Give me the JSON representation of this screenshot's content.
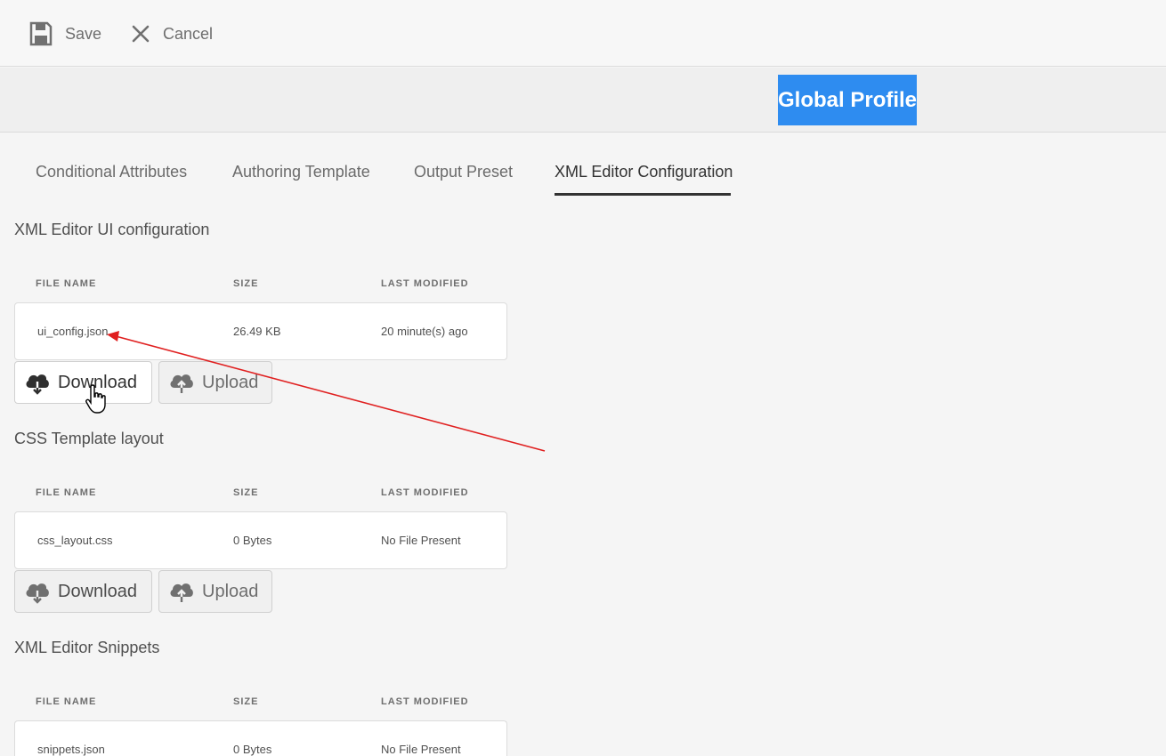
{
  "toolbar": {
    "save_label": "Save",
    "cancel_label": "Cancel"
  },
  "profile": {
    "title": "Global Profile"
  },
  "tabs": [
    {
      "label": "Conditional Attributes",
      "active": false
    },
    {
      "label": "Authoring Template",
      "active": false
    },
    {
      "label": "Output Preset",
      "active": false
    },
    {
      "label": "XML Editor Configuration",
      "active": true
    }
  ],
  "columns": {
    "file_name": "FILE NAME",
    "size": "SIZE",
    "last_modified": "LAST MODIFIED"
  },
  "sections": [
    {
      "title": "XML Editor UI configuration",
      "file": {
        "name": "ui_config.json",
        "size": "26.49 KB",
        "modified": "20 minute(s) ago"
      },
      "download_label": "Download",
      "upload_label": "Upload"
    },
    {
      "title": "CSS Template layout",
      "file": {
        "name": "css_layout.css",
        "size": "0 Bytes",
        "modified": "No File Present"
      },
      "download_label": "Download",
      "upload_label": "Upload"
    },
    {
      "title": "XML Editor Snippets",
      "file": {
        "name": "snippets.json",
        "size": "0 Bytes",
        "modified": "No File Present"
      }
    }
  ],
  "icons": {
    "save": "floppy-disk-icon",
    "cancel": "close-icon",
    "download": "cloud-download-icon",
    "upload": "cloud-upload-icon",
    "cursor": "hand-pointer-icon"
  },
  "colors": {
    "profile_highlight": "#2e8cf0",
    "annotation_arrow": "#e02020",
    "active_tab_underline": "#323232"
  }
}
